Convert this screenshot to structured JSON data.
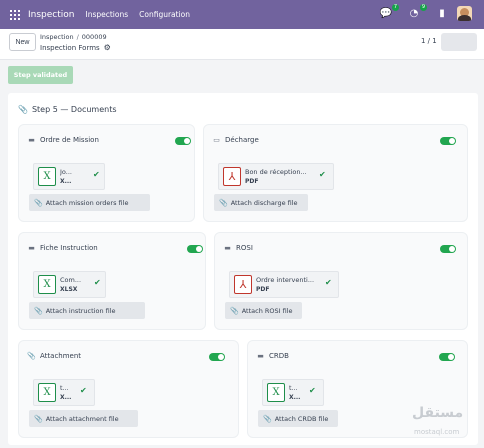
{
  "topbar": {
    "brand": "Inspection",
    "menu": [
      "Inspections",
      "Configuration"
    ],
    "chat_badge": "7",
    "activity_badge": "9"
  },
  "control": {
    "new_label": "New",
    "breadcrumb": [
      "Inspection",
      "000009"
    ],
    "record_title": "Inspection Forms",
    "pager": "1 / 1"
  },
  "status_label": "Step validated",
  "step_title": "Step 5 — Documents",
  "cards": [
    {
      "title": "Ordre de Mission",
      "file_name": "Jo...",
      "file_type": "X...",
      "file_kind": "xlsx",
      "attach_label": "Attach mission orders file",
      "enabled": true
    },
    {
      "title": "Décharge",
      "file_name": "Bon de réception...",
      "file_type": "PDF",
      "file_kind": "pdf",
      "attach_label": "Attach discharge file",
      "enabled": true
    },
    {
      "title": "Fiche Instruction",
      "file_name": "Com...",
      "file_type": "XLSX",
      "file_kind": "xlsx",
      "attach_label": "Attach instruction file",
      "enabled": true
    },
    {
      "title": "ROSI",
      "file_name": "Ordre interventi...",
      "file_type": "PDF",
      "file_kind": "pdf",
      "attach_label": "Attach ROSI file",
      "enabled": true
    },
    {
      "title": "Attachment",
      "file_name": "t...",
      "file_type": "X...",
      "file_kind": "xlsx",
      "attach_label": "Attach attachment file",
      "enabled": true
    },
    {
      "title": "CRDB",
      "file_name": "t...",
      "file_type": "X...",
      "file_kind": "xlsx",
      "attach_label": "Attach CRDB file",
      "enabled": true
    }
  ],
  "colors": {
    "topbar": "#71639e",
    "toggle_on": "#22a650",
    "status": "#a9d9b7"
  },
  "watermark": {
    "main": "مستقل",
    "sub": "mostaql.com"
  }
}
